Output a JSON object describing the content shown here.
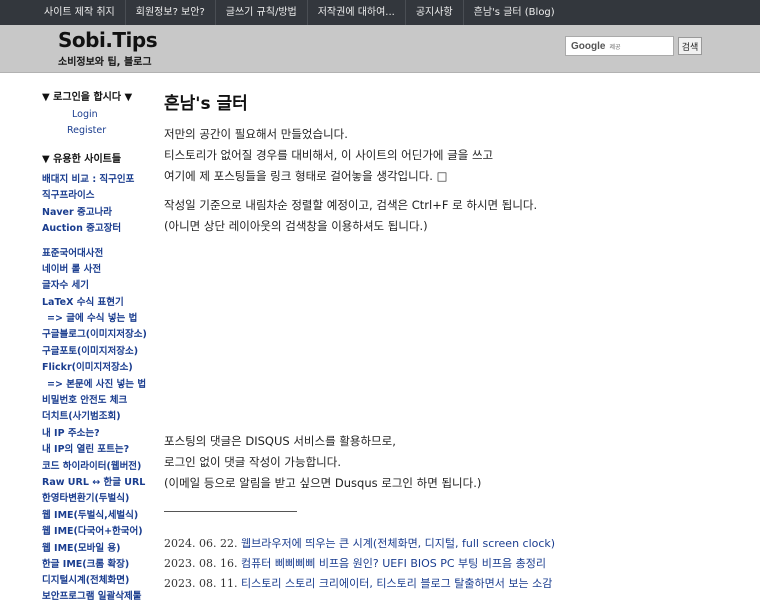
{
  "nav": {
    "items": [
      "사이트 제작 취지",
      "회원정보? 보안?",
      "글쓰기 규칙/방법",
      "저작권에 대하여...",
      "공지사항",
      "흔남's 글터 (Blog)"
    ]
  },
  "header": {
    "title": "Sobi.Tips",
    "subtitle": "소비정보와 팁, 블로그",
    "search_logo": "Google",
    "search_hint": "제공",
    "search_button": "검색"
  },
  "sidebar": {
    "login_heading": "▼ 로그인을 합시다 ▼",
    "login": "Login",
    "register": "Register",
    "links_heading": "▼ 유용한 사이트들",
    "group1": [
      "배대지 비교 : 직구인포",
      "직구프라이스",
      "Naver 중고나라",
      "Auction 중고장터"
    ],
    "group2": [
      "표준국어대사전",
      "네이버 롤 사전",
      "글자수 세기",
      "LaTeX 수식 표현기",
      "=> 글에 수식 넣는 법",
      "구글블로그(이미지저장소)",
      "구글포토(이미지저장소)",
      "Flickr(이미지저장소)",
      "=> 본문에 사진 넣는 법",
      "비밀번호 안전도 체크",
      "더치트(사기범조회)",
      "내 IP 주소는?",
      "내 IP의 열린 포트는?",
      "코드 하이라이터(웹버전)",
      "Raw URL ↔ 한글 URL",
      "한영타변환기(두벌식)",
      "웹 IME(두벌식,세벌식)",
      "웹 IME(다국어+한국어)",
      "웹 IME(모바일 용)",
      "한글 IME(크롬 확장)",
      "디지털시계(전체화면)",
      "보안프로그램 일괄삭제툴"
    ]
  },
  "main": {
    "title": "흔남's 글터",
    "intro": [
      "저만의 공간이 필요해서 만들었습니다.",
      "티스토리가 없어질 경우를 대비해서, 이 사이트의 어딘가에 글을 쓰고",
      "여기에 제 포스팅들을 링크 형태로 걸어놓을 생각입니다. □"
    ],
    "sort": [
      "작성일 기준으로 내림차순 정렬할 예정이고, 검색은 Ctrl+F 로 하시면 됩니다.",
      "(아니면 상단 레이아웃의 검색창을 이용하셔도 됩니다.)"
    ],
    "comments": [
      "포스팅의 댓글은 DISQUS 서비스를 활용하므로,",
      "로그인 없이 댓글 작성이 가능합니다.",
      "(이메일 등으로 알림을 받고 싶으면 Dusqus 로그인 하면 됩니다.)"
    ],
    "posts": [
      {
        "date": "2024. 06. 22.",
        "title": "웹브라우저에 띄우는 큰 시계(전체화면, 디지털, full screen clock)"
      },
      {
        "date": "2023. 08. 16.",
        "title": "컴퓨터 삐삐삐삐 비프음 원인? UEFI BIOS PC 부팅 비프음 총정리"
      },
      {
        "date": "2023. 08. 11.",
        "title": "티스토리 스토리 크리에이터, 티스토리 블로그 탈출하면서 보는 소감"
      }
    ]
  }
}
